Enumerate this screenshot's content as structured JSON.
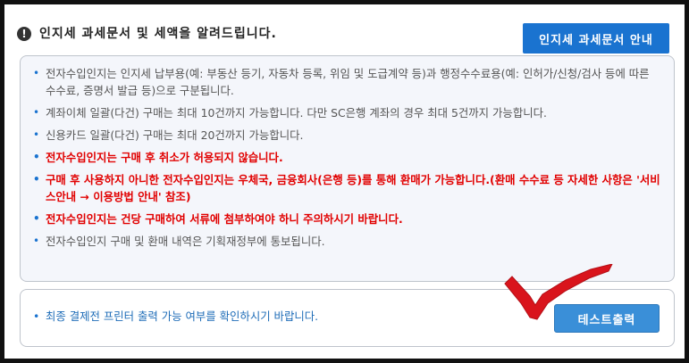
{
  "header": {
    "title": "인지세 과세문서 및 세액을 알려드립니다.",
    "guide_button": "인지세 과세문서 안내"
  },
  "notices": [
    {
      "text": "전자수입인지는 인지세 납부용(예: 부동산 등기, 자동차 등록, 위임 및 도급계약 등)과 행정수수료용(예: 인허가/신청/검사 등에 따른 수수료, 증명서 발급 등)으로 구분됩니다.",
      "emphasis": false
    },
    {
      "text": "계좌이체 일괄(다건) 구매는 최대 10건까지 가능합니다. 다만 SC은행 계좌의 경우 최대 5건까지 가능합니다.",
      "emphasis": false
    },
    {
      "text": "신용카드 일괄(다건) 구매는 최대 20건까지 가능합니다.",
      "emphasis": false
    },
    {
      "text": "전자수입인지는 구매 후 취소가 허용되지 않습니다.",
      "emphasis": true
    },
    {
      "text": "구매 후 사용하지 아니한 전자수입인지는 우체국, 금융회사(은행 등)를 통해 환매가 가능합니다.(환매 수수료 등 자세한 사항은 '서비스안내 → 이용방법 안내' 참조)",
      "emphasis": true
    },
    {
      "text": "전자수입인지는 건당 구매하여 서류에 첨부하여야 하니 주의하시기 바랍니다.",
      "emphasis": true
    },
    {
      "text": "전자수입인지 구매 및 환매 내역은 기획재정부에 통보됩니다.",
      "emphasis": false
    }
  ],
  "bottom": {
    "message": "최종 결제전 프린터 출력 가능 여부를 확인하시기 바랍니다.",
    "test_print_button": "테스트출력"
  },
  "colors": {
    "primary_blue": "#1a73d0",
    "emphasis_red": "#e10000",
    "check_red": "#d9141c"
  }
}
